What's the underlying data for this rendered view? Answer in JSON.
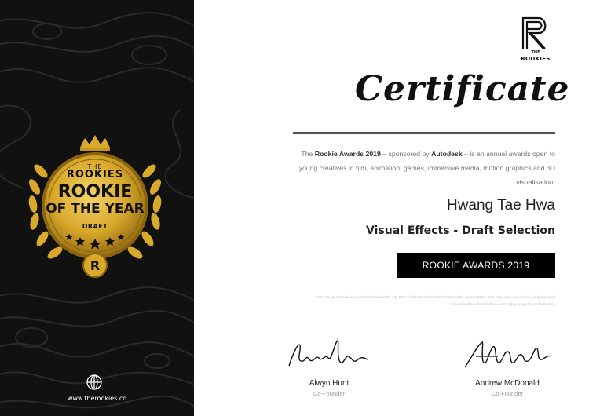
{
  "badge": {
    "the": "THE",
    "rookies": "ROOKIES",
    "line1": "ROOKIE",
    "line2": "OF THE YEAR",
    "draft": "DRAFT",
    "colors": {
      "gold": "#d9a92c",
      "gold_dark": "#8a6410",
      "panel": "#111111"
    }
  },
  "footer": {
    "website": "www.therookies.co"
  },
  "logo": {
    "letter": "R",
    "the": "THE",
    "rookies": "ROOKIES"
  },
  "certificate": {
    "title": "Certificate",
    "intro": {
      "prefix": "The ",
      "award": "Rookie Awards 2019",
      "mid": " – sponsored by ",
      "sponsor": "Autodesk",
      "suffix": " – is an annual awards open to young creatives in film, animation, games, immersive media, motion graphics and 3D visualisation."
    },
    "recipient": "Hwang Tae Hwa",
    "category": "Visual Effects - Draft Selection",
    "award_box": "ROOKIE AWARDS 2019",
    "fineprint": "Your entry performed very well and ranked in the Top 25% of all entries submitted to the Rookie Awards 2019. Your entry was reviewed by a judging panel comprising from the industries most highly respected professionals."
  },
  "signatures": [
    {
      "name": "Alwyn Hunt",
      "role": "Co-Founder"
    },
    {
      "name": "Andrew McDonald",
      "role": "Co-Founder"
    }
  ]
}
